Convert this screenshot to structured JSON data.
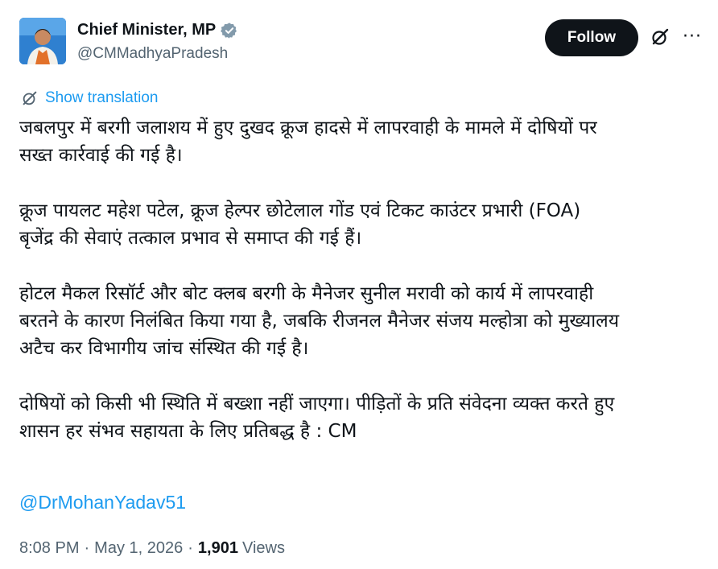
{
  "author": {
    "name": "Chief Minister, MP",
    "handle": "@CMMadhyaPradesh"
  },
  "actions": {
    "follow_label": "Follow",
    "more_label": "···"
  },
  "translate_label": "Show translation",
  "tweet": {
    "paragraphs": [
      [
        "जबलपुर में बरगी जलाशय में हुए दुखद क्रूज हादसे में लापरवाही के मामले में दोषियों पर",
        "सख्त कार्रवाई की गई है।"
      ],
      [
        "क्रूज पायलट महेश पटेल, क्रूज हेल्पर छोटेलाल गोंड एवं टिकट काउंटर प्रभारी (FOA)",
        "बृजेंद्र की सेवाएं तत्काल प्रभाव से समाप्त की गई हैं।"
      ],
      [
        "होटल मैकल रिसॉर्ट और बोट क्लब बरगी के मैनेजर सुनील मरावी को कार्य में लापरवाही",
        "बरतने के कारण निलंबित किया गया है, जबकि रीजनल मैनेजर संजय मल्होत्रा को मुख्यालय",
        "अटैच कर विभागीय जांच संस्थित की गई है।"
      ],
      [
        "दोषियों को किसी भी स्थिति में बख्शा नहीं जाएगा। पीड़ितों के प्रति संवेदना व्यक्त करते हुए",
        "शासन हर संभव सहायता के लिए प्रतिबद्ध है : CM"
      ]
    ],
    "mention": "@DrMohanYadav51"
  },
  "meta": {
    "time": "8:08 PM",
    "separator": "·",
    "date": "May 1, 2026",
    "views_count": "1,901",
    "views_label": "Views"
  },
  "colors": {
    "link": "#1d9bf0",
    "text": "#0f1419",
    "muted": "#536471",
    "follow_bg": "#0f1419"
  },
  "icons": [
    "verified-badge-icon",
    "grok-icon",
    "more-icon",
    "translate-icon"
  ]
}
